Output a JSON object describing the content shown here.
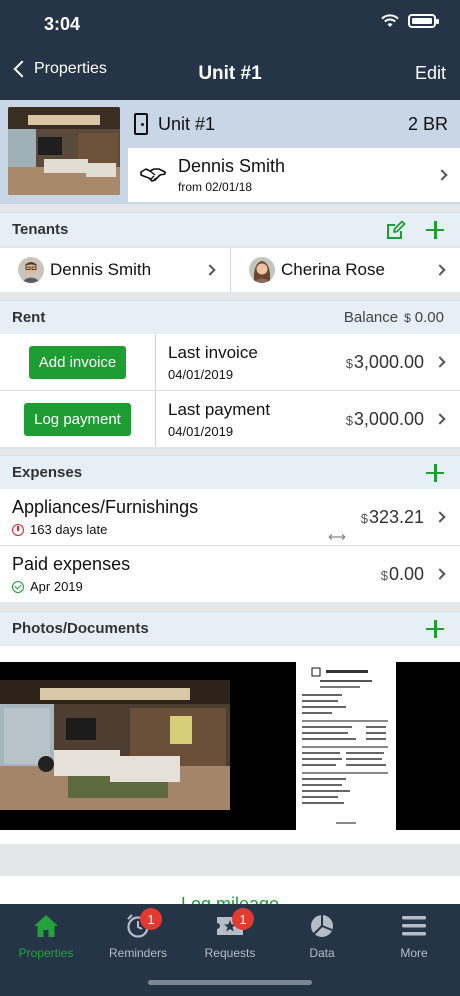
{
  "status": {
    "time": "3:04"
  },
  "nav": {
    "back_label": "Properties",
    "title": "Unit #1",
    "edit_label": "Edit"
  },
  "unit": {
    "name": "Unit #1",
    "bedrooms": "2 BR",
    "lease_tenant": "Dennis Smith",
    "lease_since": "from 02/01/18"
  },
  "tenants": {
    "header": "Tenants",
    "items": [
      {
        "name": "Dennis Smith"
      },
      {
        "name": "Cherina Rose"
      }
    ]
  },
  "rent": {
    "header": "Rent",
    "balance_label": "Balance",
    "balance_currency": "$",
    "balance_value": "0.00",
    "rows": [
      {
        "button": "Add invoice",
        "title": "Last invoice",
        "date": "04/01/2019",
        "currency": "$",
        "amount": "3,000.00"
      },
      {
        "button": "Log payment",
        "title": "Last payment",
        "date": "04/01/2019",
        "currency": "$",
        "amount": "3,000.00"
      }
    ]
  },
  "expenses": {
    "header": "Expenses",
    "rows": [
      {
        "title": "Appliances/Furnishings",
        "status": "163 days late",
        "status_icon": "alert-icon",
        "currency": "$",
        "amount": "323.21"
      },
      {
        "title": "Paid expenses",
        "status": "Apr 2019",
        "status_icon": "check-icon",
        "currency": "$",
        "amount": "0.00"
      }
    ]
  },
  "photos": {
    "header": "Photos/Documents"
  },
  "mileage": {
    "label": "Log mileage"
  },
  "tabbar": {
    "items": [
      {
        "label": "Properties",
        "icon": "home-icon",
        "active": true
      },
      {
        "label": "Reminders",
        "icon": "alarm-clock-icon",
        "badge": "1"
      },
      {
        "label": "Requests",
        "icon": "ticket-icon",
        "badge": "1"
      },
      {
        "label": "Data",
        "icon": "pie-chart-icon"
      },
      {
        "label": "More",
        "icon": "menu-icon"
      }
    ]
  },
  "colors": {
    "nav_bg": "#253447",
    "accent": "#1e9d33",
    "header_bg": "#c8d6e6",
    "section_bg": "#e6eef6",
    "badge": "#e23a2e"
  }
}
